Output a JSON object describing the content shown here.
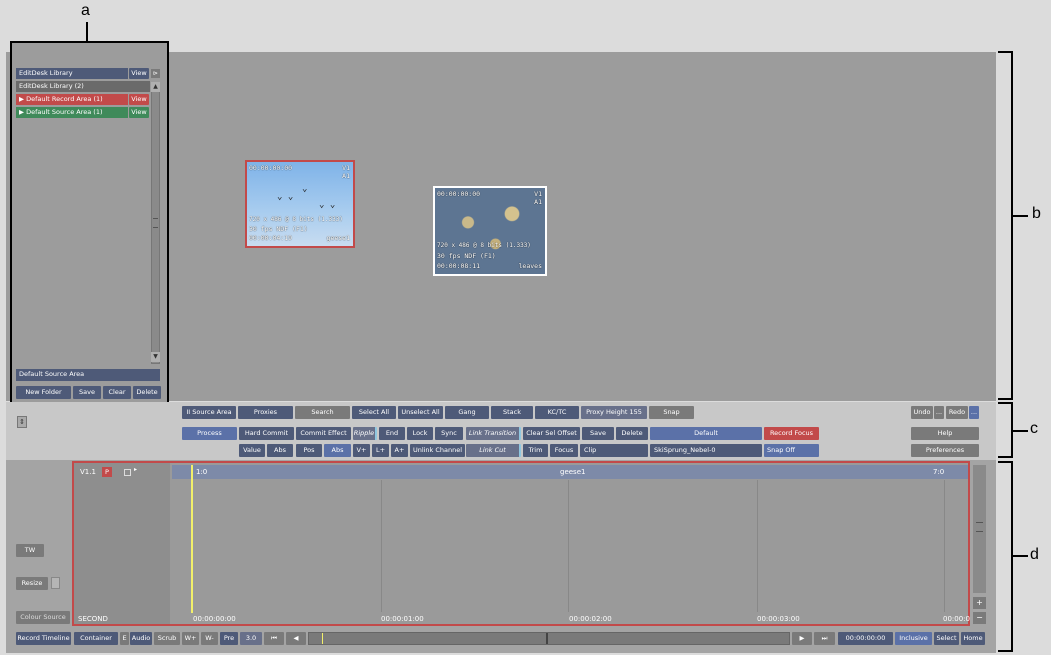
{
  "callouts": {
    "a": "a",
    "b": "b",
    "c": "c",
    "d": "d"
  },
  "library": {
    "header": "EditDesk Library",
    "header_view": "View",
    "sub": "EditDesk Library (2)",
    "items": [
      {
        "label": "Default Record Area (1)",
        "view": "View",
        "color": "#c24a4a"
      },
      {
        "label": "Default Source Area (1)",
        "view": "View",
        "color": "#3f8a5a"
      }
    ],
    "footer_label": "Default Source Area",
    "buttons": [
      "New Folder",
      "Save",
      "Clear",
      "Delete"
    ]
  },
  "clips": [
    {
      "tc": "00:00:00:00",
      "track": "V1",
      "track2": "A1",
      "res": "720 x 486 @ 8 bits (1.333)",
      "rate": "30 fps NDF (F1)",
      "dur": "00:00:04:19",
      "name": "geese1"
    },
    {
      "tc": "00:00:00:00",
      "track": "V1",
      "track2": "A1",
      "res": "720 x 486 @ 8 bits (1.333)",
      "rate": "30 fps NDF (F1)",
      "dur": "00:00:08:11",
      "name": "leaves"
    }
  ],
  "toolbar": {
    "row1": [
      "II Source Area",
      "Proxies",
      "Search",
      "Select All",
      "Unselect All",
      "Gang",
      "Stack",
      "KC/TC",
      "Proxy Height 155",
      "Snap"
    ],
    "row1_right": [
      "Undo",
      "...",
      "Redo",
      "..."
    ],
    "row2": [
      "Process",
      "Hard Commit",
      "Commit Effect",
      "Ripple",
      "End",
      "Lock",
      "Sync",
      "Link Transition",
      "Clear Sel Offset",
      "Save",
      "Delete",
      "Default",
      "Record Focus"
    ],
    "row2_right": "Help",
    "row3": [
      "Value",
      "Abs",
      "Pos",
      "Abs",
      "V+",
      "L+",
      "A+",
      "Unlink Channel",
      "Link Cut",
      "Trim",
      "Focus",
      "Clip",
      "SkiSprung_Nebel-0",
      "Snap Off"
    ],
    "row3_right": "Preferences"
  },
  "timeline": {
    "track": "V1.1",
    "p_badge": "P",
    "clip_start": "1:0",
    "clip_name": "geese1",
    "clip_end": "7:0",
    "scale_label": "SECOND",
    "ticks": [
      "00:00:00:00",
      "00:00:01:00",
      "00:00:02:00",
      "00:00:03:00",
      "00:00:0"
    ],
    "left_buttons": [
      "TW",
      "Resize",
      "Colour Source"
    ],
    "bottom": [
      "Record Timeline",
      "Container",
      "E",
      "Audio",
      "Scrub",
      "W+",
      "W-",
      "Pre",
      "3.0"
    ],
    "timecode": "00:00:00:00",
    "bottom_right": [
      "Inclusive",
      "Select",
      "Home"
    ]
  }
}
